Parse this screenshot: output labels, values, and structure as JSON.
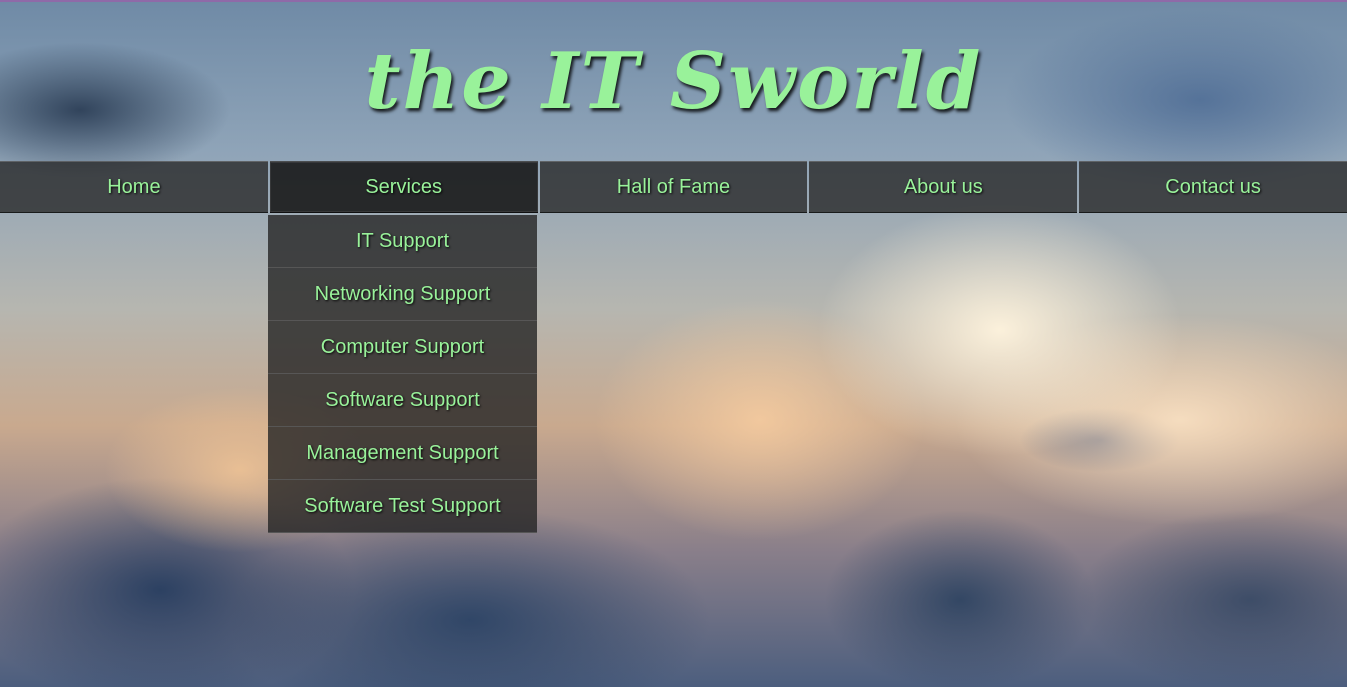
{
  "brand": {
    "logo_text": "the IT Sworld"
  },
  "colors": {
    "menu_text": "#99f29a",
    "menu_bg": "#262626",
    "accent_line": "#8f6aa8"
  },
  "nav": {
    "items": [
      {
        "label": "Home"
      },
      {
        "label": "Services"
      },
      {
        "label": "Hall of Fame"
      },
      {
        "label": "About us"
      },
      {
        "label": "Contact us"
      }
    ],
    "active": "Services"
  },
  "services_menu": {
    "items": [
      {
        "label": "IT Support"
      },
      {
        "label": "Networking Support"
      },
      {
        "label": "Computer Support"
      },
      {
        "label": "Software Support"
      },
      {
        "label": "Management Support"
      },
      {
        "label": "Software Test Support"
      }
    ]
  }
}
